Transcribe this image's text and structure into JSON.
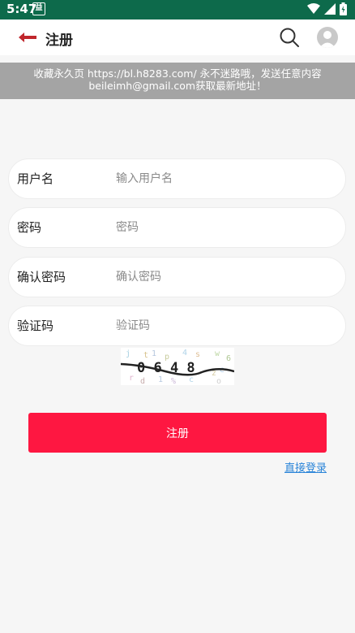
{
  "status_bar": {
    "time": "5:47",
    "notif_glyph": "益"
  },
  "header": {
    "title": "注册"
  },
  "notice": {
    "line1": "收藏永久页 https://bl.h8283.com/ 永不迷路哦，发送任意内容",
    "line2": "beileimh@gmail.com获取最新地址！"
  },
  "form": {
    "username": {
      "label": "用户名",
      "placeholder": "输入用户名"
    },
    "password": {
      "label": "密码",
      "placeholder": "密码"
    },
    "confirm": {
      "label": "确认密码",
      "placeholder": "确认密码"
    },
    "captcha": {
      "label": "验证码",
      "placeholder": "验证码",
      "code": "0 6 4 8"
    },
    "submit_label": "注册",
    "login_link": "直接登录"
  },
  "colors": {
    "status_bar": "#0d6a4b",
    "accent": "#fe1741",
    "back_arrow": "#c0262c",
    "link": "#2a84d8",
    "notice_bg": "#a4a4a4"
  },
  "icons": {
    "back": "arrow-left-icon",
    "search": "search-icon",
    "avatar": "user-avatar-icon",
    "wifi": "wifi-icon",
    "signal": "signal-icon",
    "battery": "battery-icon"
  }
}
